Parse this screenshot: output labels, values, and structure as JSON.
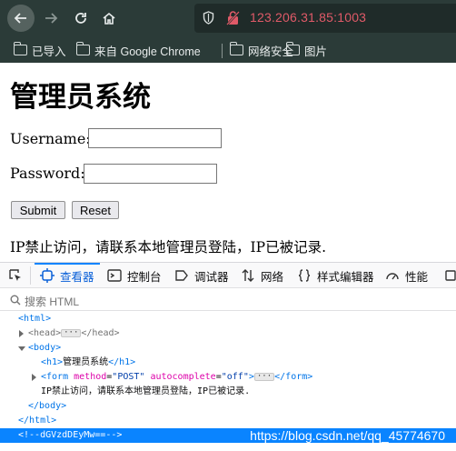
{
  "browser": {
    "url": "123.206.31.85:1003",
    "bookmarks": [
      "已导入",
      "来自 Google Chrome",
      "网络安全",
      "图片"
    ]
  },
  "page": {
    "title": "管理员系统",
    "username_label": "Username:",
    "password_label": "Password:",
    "username_value": "",
    "password_value": "",
    "submit_label": "Submit",
    "reset_label": "Reset",
    "notice": "IP禁止访问，请联系本地管理员登陆，IP已被记录."
  },
  "devtools": {
    "tabs": [
      "查看器",
      "控制台",
      "调试器",
      "网络",
      "样式编辑器",
      "性能"
    ],
    "search_placeholder": "搜索 HTML",
    "tree": {
      "html_open": "<html>",
      "head_open": "<head>",
      "ellipsis": "···",
      "head_close": "</head>",
      "body_open": "<body>",
      "h1_open": "<h1>",
      "h1_text": "管理员系统",
      "h1_close": "</h1>",
      "form_open": "<form",
      "form_attr1_name": "method",
      "form_attr1_value": "\"POST\"",
      "form_attr2_name": "autocomplete",
      "form_attr2_value": "\"off\"",
      "form_gt": ">",
      "form_close": "</form>",
      "text_node": "IP禁止访问，请联系本地管理员登陆，IP已被记录.",
      "body_close": "</body>",
      "html_close": "</html>",
      "comment": "<!--dGVzdDEyMw==-->"
    },
    "watermark": "https://blog.csdn.net/qq_45774670"
  },
  "colors": {
    "chrome_bg": "#2b3b38",
    "url_text": "#e05a68",
    "devtools_accent": "#0a84ff",
    "tag": "#0074e8",
    "attr": "#dd00a9",
    "value": "#003eaa"
  }
}
